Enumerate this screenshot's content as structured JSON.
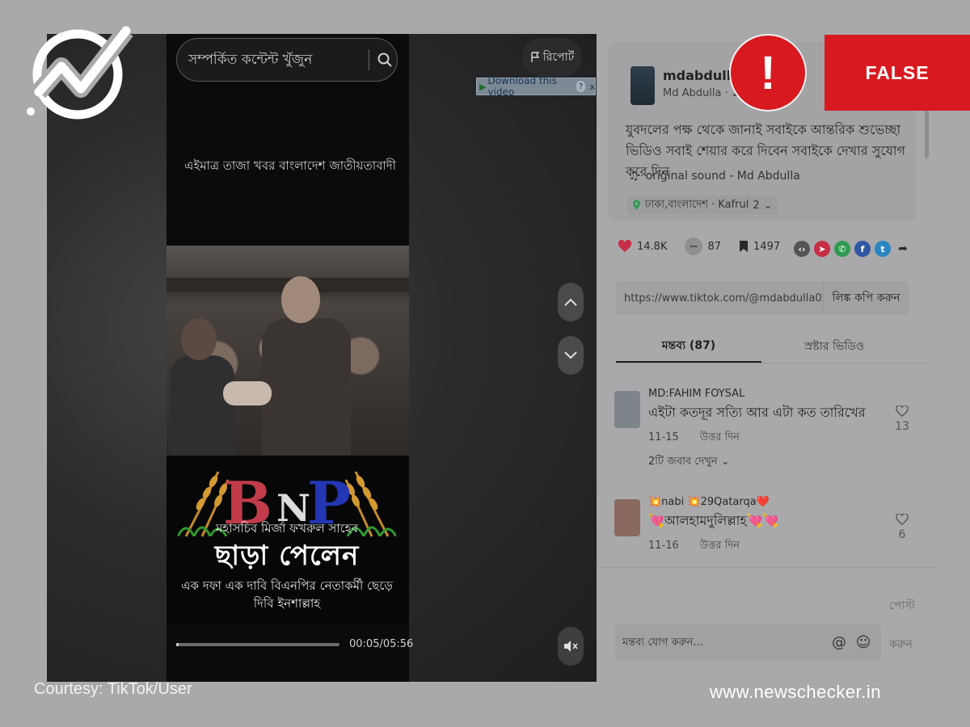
{
  "video": {
    "search_placeholder": "সম্পর্কিত কন্টেন্ট খুঁজুন",
    "report_label": "রিপোর্ট",
    "download_label": "Download this video",
    "download_help": "?",
    "download_close": "x",
    "headline_top": "এইমাত্র তাজা খবর বাংলাদেশ জাতীয়তাবাদী",
    "logo_b": "B",
    "logo_n": "N",
    "logo_p": "P",
    "sub_title": "মহাসচিব মির্জা ফখরুল সাহেব",
    "big_title": "ছাড়া পেলেন",
    "caption_line1": "এক দফা এক দাবি বিএনপির নেতাকর্মী ছেড়ে",
    "caption_line2": "দিবি ইনশাল্লাহ",
    "time": "00:05/05:56",
    "progress_fraction": 0.015
  },
  "post": {
    "username": "mdabdulla020",
    "user_info": "Md Abdulla · 11-5",
    "description": "যুবদলের পক্ষ থেকে জানাই সবাইকে আন্তরিক শুভেচ্ছা ভিডিও সবাই শেয়ার করে দিবেন সবাইকে দেখার সুযোগ করে দিন",
    "sound": "original sound - Md Abdulla",
    "location": "ঢাকা,বাংলাদেশ · Kafrul",
    "location_more": "2",
    "likes": "14.8K",
    "comments": "87",
    "saves": "1497",
    "link_url": "https://www.tiktok.com/@mdabdulla0206/vide...",
    "copy_link_label": "লিঙ্ক কপি করুন"
  },
  "tabs": [
    {
      "label": "মন্তব্য (87)"
    },
    {
      "label": "স্রষ্টার ভিডিও"
    }
  ],
  "comments": [
    {
      "name": "MD:FAHIM FOYSAL",
      "text": "এইটা কতদূর সত্যি আর এটা কত তারিখের",
      "date": "11-15",
      "reply_label": "উত্তর দিন",
      "likes": "13",
      "view_replies": "2টি জবাব দেখুন"
    },
    {
      "name": "💥nabi 💥29Qatarqa❤️",
      "text": "💘আলহামদুলিল্লাহ💘💘",
      "date": "11-16",
      "reply_label": "উত্তর দিন",
      "likes": "6"
    }
  ],
  "composer": {
    "post_label": "পোস্ট",
    "placeholder": "মন্তব্য যোগ করুন...",
    "send_label": "করুন"
  },
  "badge": {
    "verdict": "FALSE",
    "exclamation": "!"
  },
  "footer": {
    "courtesy": "Courtesy: TikTok/User",
    "site": "www.newschecker.in"
  },
  "colors": {
    "verdict_red": "#d81a20",
    "bnp_red": "#c13b4a",
    "bnp_blue": "#2336b3"
  },
  "icons": {
    "search": "search-icon",
    "flag": "flag-icon",
    "like": "heart-icon",
    "comment": "comment-icon",
    "save": "bookmark-icon"
  }
}
